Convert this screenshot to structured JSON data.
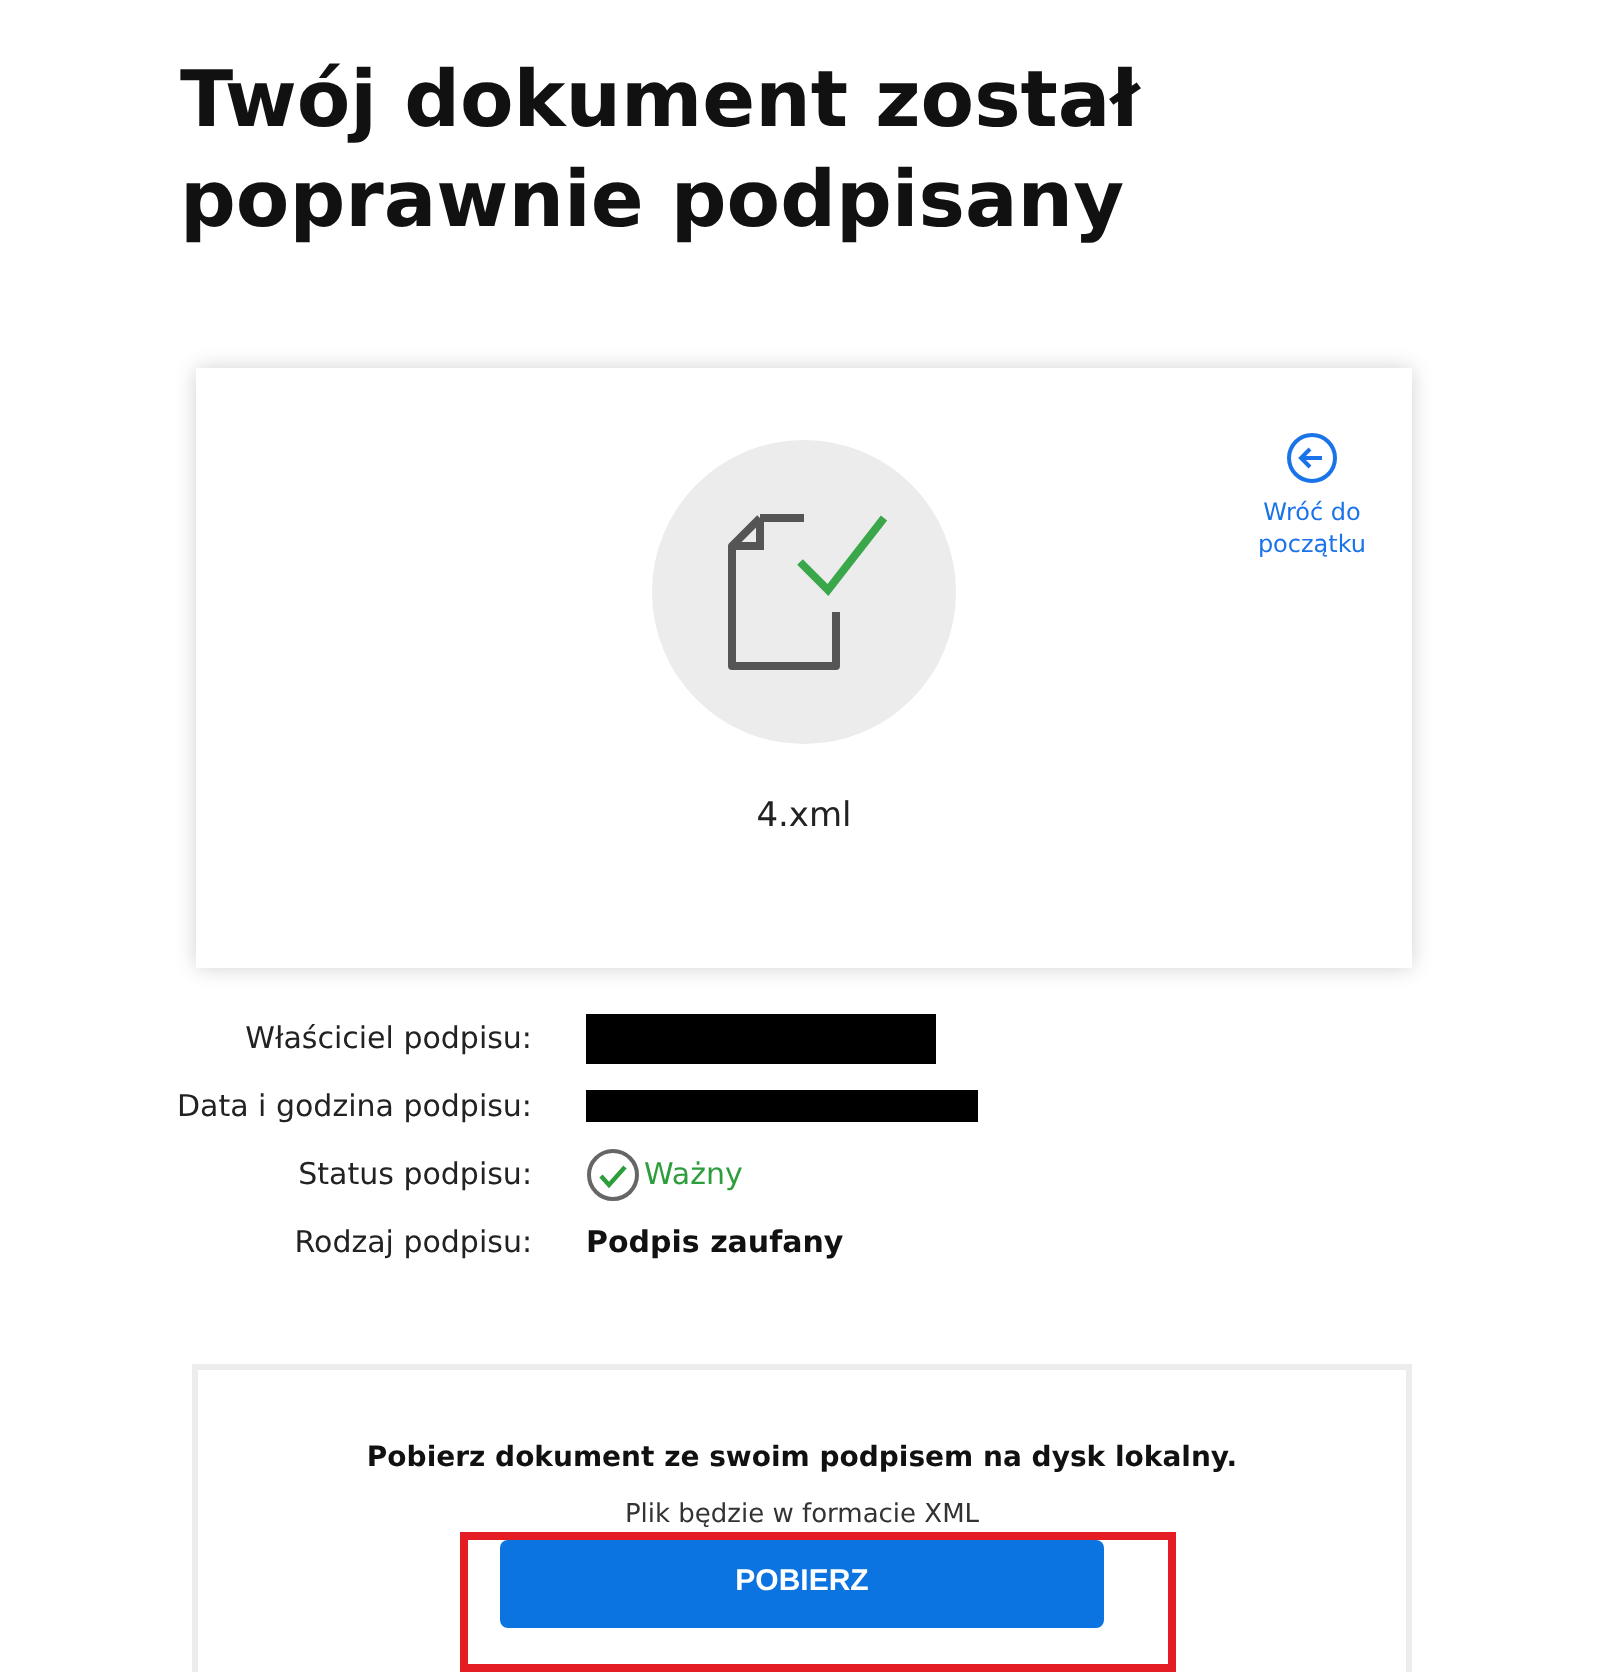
{
  "title": "Twój dokument został poprawnie podpisany",
  "document": {
    "file_name": "4.xml",
    "back_link": "Wróć do początku"
  },
  "details": [
    {
      "kind": "redacted",
      "label": "Właściciel podpisu:"
    },
    {
      "kind": "redacted",
      "label": "Data i godzina podpisu:"
    },
    {
      "kind": "status",
      "label": "Status podpisu:",
      "value": "Ważny",
      "valid": true
    },
    {
      "kind": "text",
      "label": "Rodzaj podpisu:",
      "value": "Podpis zaufany"
    }
  ],
  "download": {
    "heading": "Pobierz dokument ze swoim podpisem na dysk lokalny.",
    "note": "Plik będzie w formacie XML",
    "button": "POBIERZ",
    "highlighted": true
  }
}
